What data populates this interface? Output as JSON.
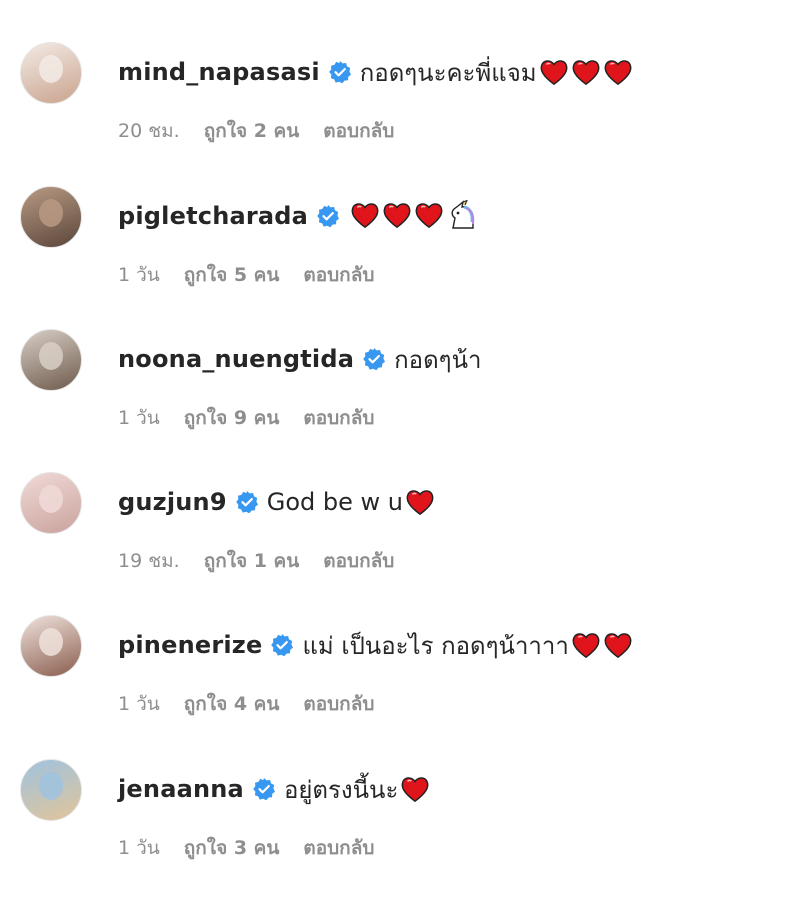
{
  "colors": {
    "verified": "#3897f0",
    "heart": "#e0141b",
    "muted": "#8e8e8e"
  },
  "comments": [
    {
      "username": "mind_napasasi",
      "text": "กอดๆนะคะพี่แจม",
      "emoji": [
        "red-heart",
        "red-heart",
        "red-heart"
      ],
      "time": "20 ชม.",
      "likes": "ถูกใจ 2 คน",
      "reply": "ตอบกลับ",
      "avatar_colors": [
        "#f3ebe6",
        "#c9a38d"
      ]
    },
    {
      "username": "pigletcharada",
      "text": "",
      "emoji": [
        "red-heart",
        "red-heart",
        "red-heart",
        "unicorn"
      ],
      "time": "1 วัน",
      "likes": "ถูกใจ 5 คน",
      "reply": "ตอบกลับ",
      "avatar_colors": [
        "#b89a84",
        "#5b463a"
      ]
    },
    {
      "username": "noona_nuengtida",
      "text": "กอดๆน้า",
      "emoji": [],
      "time": "1 วัน",
      "likes": "ถูกใจ 9 คน",
      "reply": "ตอบกลับ",
      "avatar_colors": [
        "#d8cfc6",
        "#6e5a4c"
      ]
    },
    {
      "username": "guzjun9",
      "text": "God be w u",
      "emoji": [
        "red-heart"
      ],
      "time": "19 ชม.",
      "likes": "ถูกใจ 1 คน",
      "reply": "ตอบกลับ",
      "avatar_colors": [
        "#f0dad8",
        "#caa39c"
      ]
    },
    {
      "username": "pinenerize",
      "text": "แม่ เป็นอะไร กอดๆน้าาาา",
      "emoji": [
        "red-heart",
        "red-heart"
      ],
      "time": "1 วัน",
      "likes": "ถูกใจ 4 คน",
      "reply": "ตอบกลับ",
      "avatar_colors": [
        "#efe2dc",
        "#8b5e4f"
      ]
    },
    {
      "username": "jenaanna",
      "text": "อยู่ตรงนี้นะ",
      "emoji": [
        "red-heart"
      ],
      "time": "1 วัน",
      "likes": "ถูกใจ 3 คน",
      "reply": "ตอบกลับ",
      "avatar_colors": [
        "#9fc3df",
        "#e1c49a"
      ]
    }
  ]
}
